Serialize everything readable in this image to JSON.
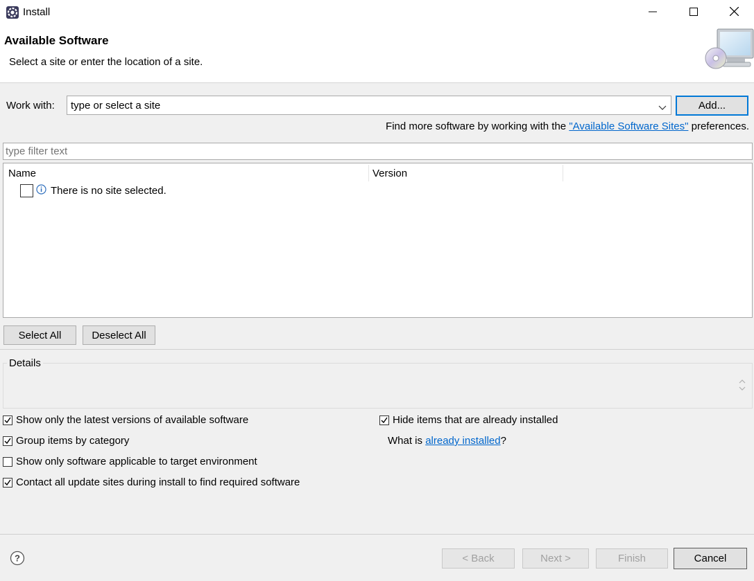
{
  "window": {
    "title": "Install",
    "icon": "eclipse-gear-icon",
    "controls": [
      "minimize-icon",
      "maximize-icon",
      "close-icon"
    ]
  },
  "header": {
    "title": "Available Software",
    "description": "Select a site or enter the location of a site.",
    "image": "monitor-cd-icon"
  },
  "work_with": {
    "label": "Work with:",
    "value": "type or select a site",
    "add_label": "Add...",
    "hint_prefix": "Find more software by working with the ",
    "hint_link": "\"Available Software Sites\"",
    "hint_suffix": " preferences."
  },
  "filter": {
    "placeholder": "type filter text"
  },
  "table": {
    "columns": [
      "Name",
      "Version"
    ],
    "rows": [
      {
        "text": "There is no site selected.",
        "checked": false,
        "icon": "info-icon"
      }
    ]
  },
  "selection_buttons": {
    "select_all": "Select All",
    "deselect_all": "Deselect All"
  },
  "details": {
    "label": "Details"
  },
  "options": {
    "show_latest": {
      "label": "Show only the latest versions of available software",
      "checked": true
    },
    "group_by_category": {
      "label": "Group items by category",
      "checked": true
    },
    "show_applicable": {
      "label": "Show only software applicable to target environment",
      "checked": false
    },
    "contact_sites": {
      "label": "Contact all update sites during install to find required software",
      "checked": true
    },
    "hide_installed": {
      "label": "Hide items that are already installed",
      "checked": true
    },
    "what_is_prefix": "What is ",
    "what_is_link": "already installed",
    "what_is_suffix": "?"
  },
  "footer": {
    "help_icon": "help-icon",
    "back": "< Back",
    "next": "Next >",
    "finish": "Finish",
    "cancel": "Cancel"
  }
}
